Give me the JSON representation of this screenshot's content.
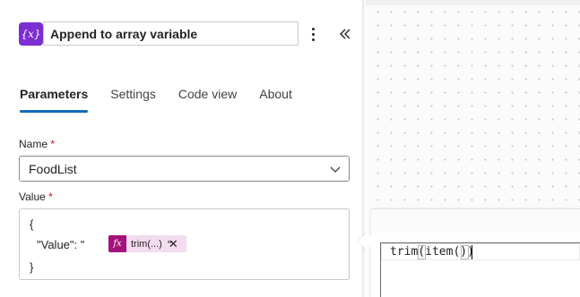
{
  "action": {
    "icon_glyph": "{x}",
    "icon_name": "variable-icon",
    "title": "Append to array variable",
    "more_icon": "more-vertical-icon",
    "collapse_icon": "double-chevron-left-icon"
  },
  "tabs": [
    {
      "label": "Parameters",
      "active": true
    },
    {
      "label": "Settings",
      "active": false
    },
    {
      "label": "Code view",
      "active": false
    },
    {
      "label": "About",
      "active": false
    }
  ],
  "fields": {
    "name": {
      "label": "Name",
      "required_mark": "*",
      "value": "FoodList"
    },
    "value": {
      "label": "Value",
      "required_mark": "*",
      "line1": "{",
      "line2_prefix": "\"Value\": \"",
      "line2_suffix": "\"",
      "line3": "}",
      "token": {
        "glyph": "fx",
        "label": "trim(...)",
        "remove": "✕"
      }
    }
  },
  "expression_editor": {
    "text": "trim(item())"
  },
  "colors": {
    "action_icon_bg": "#7b2fd1",
    "tab_underline": "#0f6cbd",
    "token_fx_bg": "#a4127c",
    "token_bg": "#f3dcef",
    "required": "#c50f1f"
  }
}
